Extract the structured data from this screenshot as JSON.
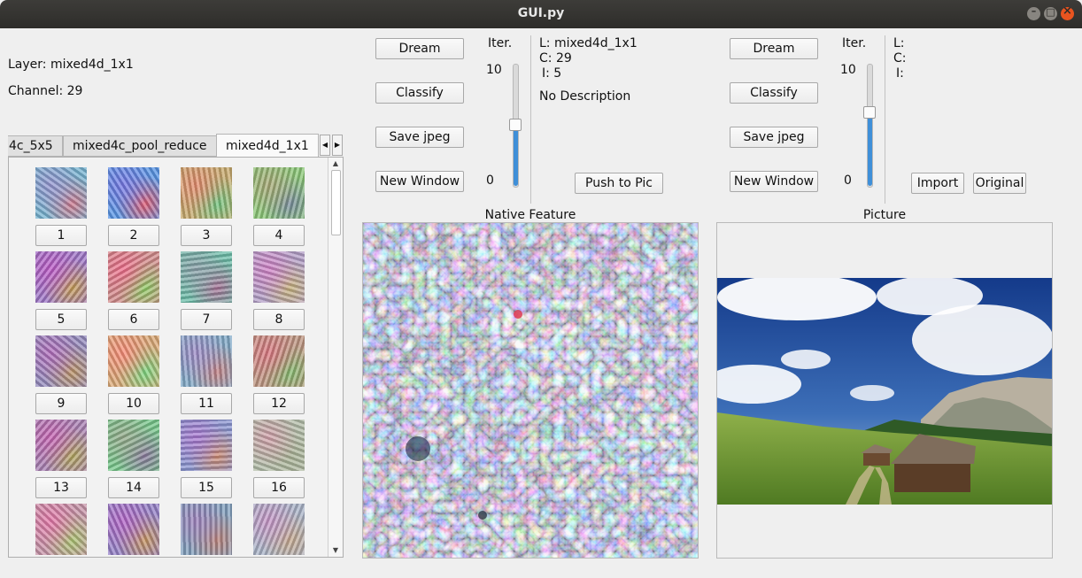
{
  "window": {
    "title": "GUI.py"
  },
  "info": {
    "layer": "Layer: mixed4d_1x1",
    "channel": "Channel: 29"
  },
  "tabs": [
    {
      "label": "4c_5x5",
      "active": false
    },
    {
      "label": "mixed4c_pool_reduce",
      "active": false
    },
    {
      "label": "mixed4d_1x1",
      "active": true
    }
  ],
  "tab_arrows": {
    "left": "◀",
    "right": "▶"
  },
  "gallery": {
    "scroll_up": "▲",
    "scroll_down": "▼",
    "items": [
      "1",
      "2",
      "3",
      "4",
      "5",
      "6",
      "7",
      "8",
      "9",
      "10",
      "11",
      "12",
      "13",
      "14",
      "15",
      "16",
      "",
      "",
      "",
      ""
    ]
  },
  "left_controls": {
    "dream": "Dream",
    "classify": "Classify",
    "save": "Save jpeg",
    "new_window": "New Window",
    "iter_label": "Iter.",
    "iter_max": "10",
    "iter_min": "0",
    "iter_level": 0.5
  },
  "left_info": {
    "l": "L: mixed4d_1x1",
    "c": "C: 29",
    "i": "I: 5",
    "description": "No Description",
    "push": "Push to Pic"
  },
  "right_controls": {
    "dream": "Dream",
    "classify": "Classify",
    "save": "Save jpeg",
    "new_window": "New Window",
    "iter_label": "Iter.",
    "iter_max": "10",
    "iter_min": "0",
    "iter_level": 0.6
  },
  "right_info": {
    "l": "L:",
    "c": "C:",
    "i": "I:",
    "import": "Import",
    "original": "Original"
  },
  "panels": {
    "native": "Native Feature",
    "picture": "Picture"
  },
  "colors": {
    "slider_fill": "#3f8fd8",
    "close_button": "#e9541f",
    "titlebar": "#2e2d2a"
  }
}
